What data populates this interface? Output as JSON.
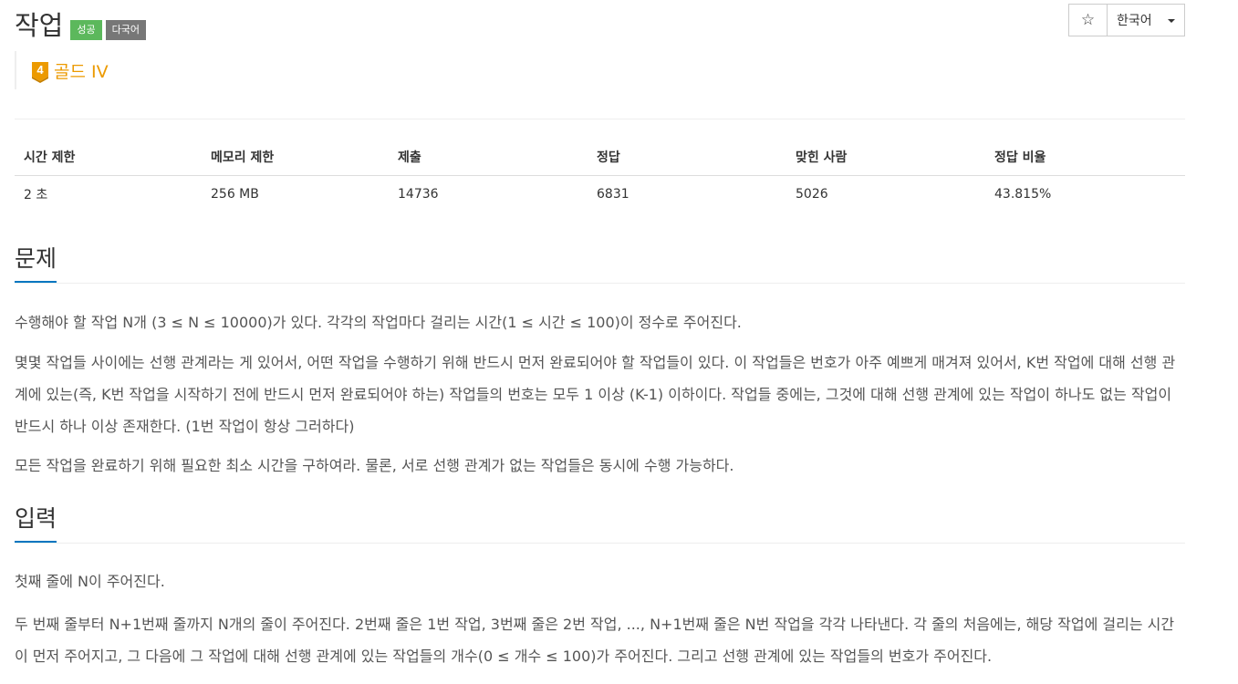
{
  "header": {
    "title": "작업",
    "badges": [
      "성공",
      "다국어"
    ],
    "star_icon": "☆",
    "language": "한국어"
  },
  "tier": {
    "number": "4",
    "label": "골드 IV",
    "color": "#ec9a00"
  },
  "info_table": {
    "headers": [
      "시간 제한",
      "메모리 제한",
      "제출",
      "정답",
      "맞힌 사람",
      "정답 비율"
    ],
    "values": [
      "2 초",
      "256 MB",
      "14736",
      "6831",
      "5026",
      "43.815%"
    ]
  },
  "sections": {
    "problem": {
      "title": "문제",
      "paragraphs": [
        "수행해야 할 작업 N개 (3 ≤ N ≤ 10000)가 있다. 각각의 작업마다 걸리는 시간(1 ≤ 시간 ≤ 100)이 정수로 주어진다.",
        "몇몇 작업들 사이에는 선행 관계라는 게 있어서, 어떤 작업을 수행하기 위해 반드시 먼저 완료되어야 할 작업들이 있다. 이 작업들은 번호가 아주 예쁘게 매겨져 있어서, K번 작업에 대해 선행 관계에 있는(즉, K번 작업을 시작하기 전에 반드시 먼저 완료되어야 하는) 작업들의 번호는 모두 1 이상 (K-1) 이하이다. 작업들 중에는, 그것에 대해 선행 관계에 있는 작업이 하나도 없는 작업이 반드시 하나 이상 존재한다. (1번 작업이 항상 그러하다)",
        "모든 작업을 완료하기 위해 필요한 최소 시간을 구하여라. 물론, 서로 선행 관계가 없는 작업들은 동시에 수행 가능하다."
      ]
    },
    "input": {
      "title": "입력",
      "paragraphs": [
        "첫째 줄에 N이 주어진다.",
        "두 번째 줄부터 N+1번째 줄까지 N개의 줄이 주어진다. 2번째 줄은 1번 작업, 3번째 줄은 2번 작업, ..., N+1번째 줄은 N번 작업을 각각 나타낸다. 각 줄의 처음에는, 해당 작업에 걸리는 시간이 먼저 주어지고, 그 다음에 그 작업에 대해 선행 관계에 있는 작업들의 개수(0 ≤ 개수 ≤ 100)가 주어진다. 그리고 선행 관계에 있는 작업들의 번호가 주어진다."
      ]
    }
  }
}
